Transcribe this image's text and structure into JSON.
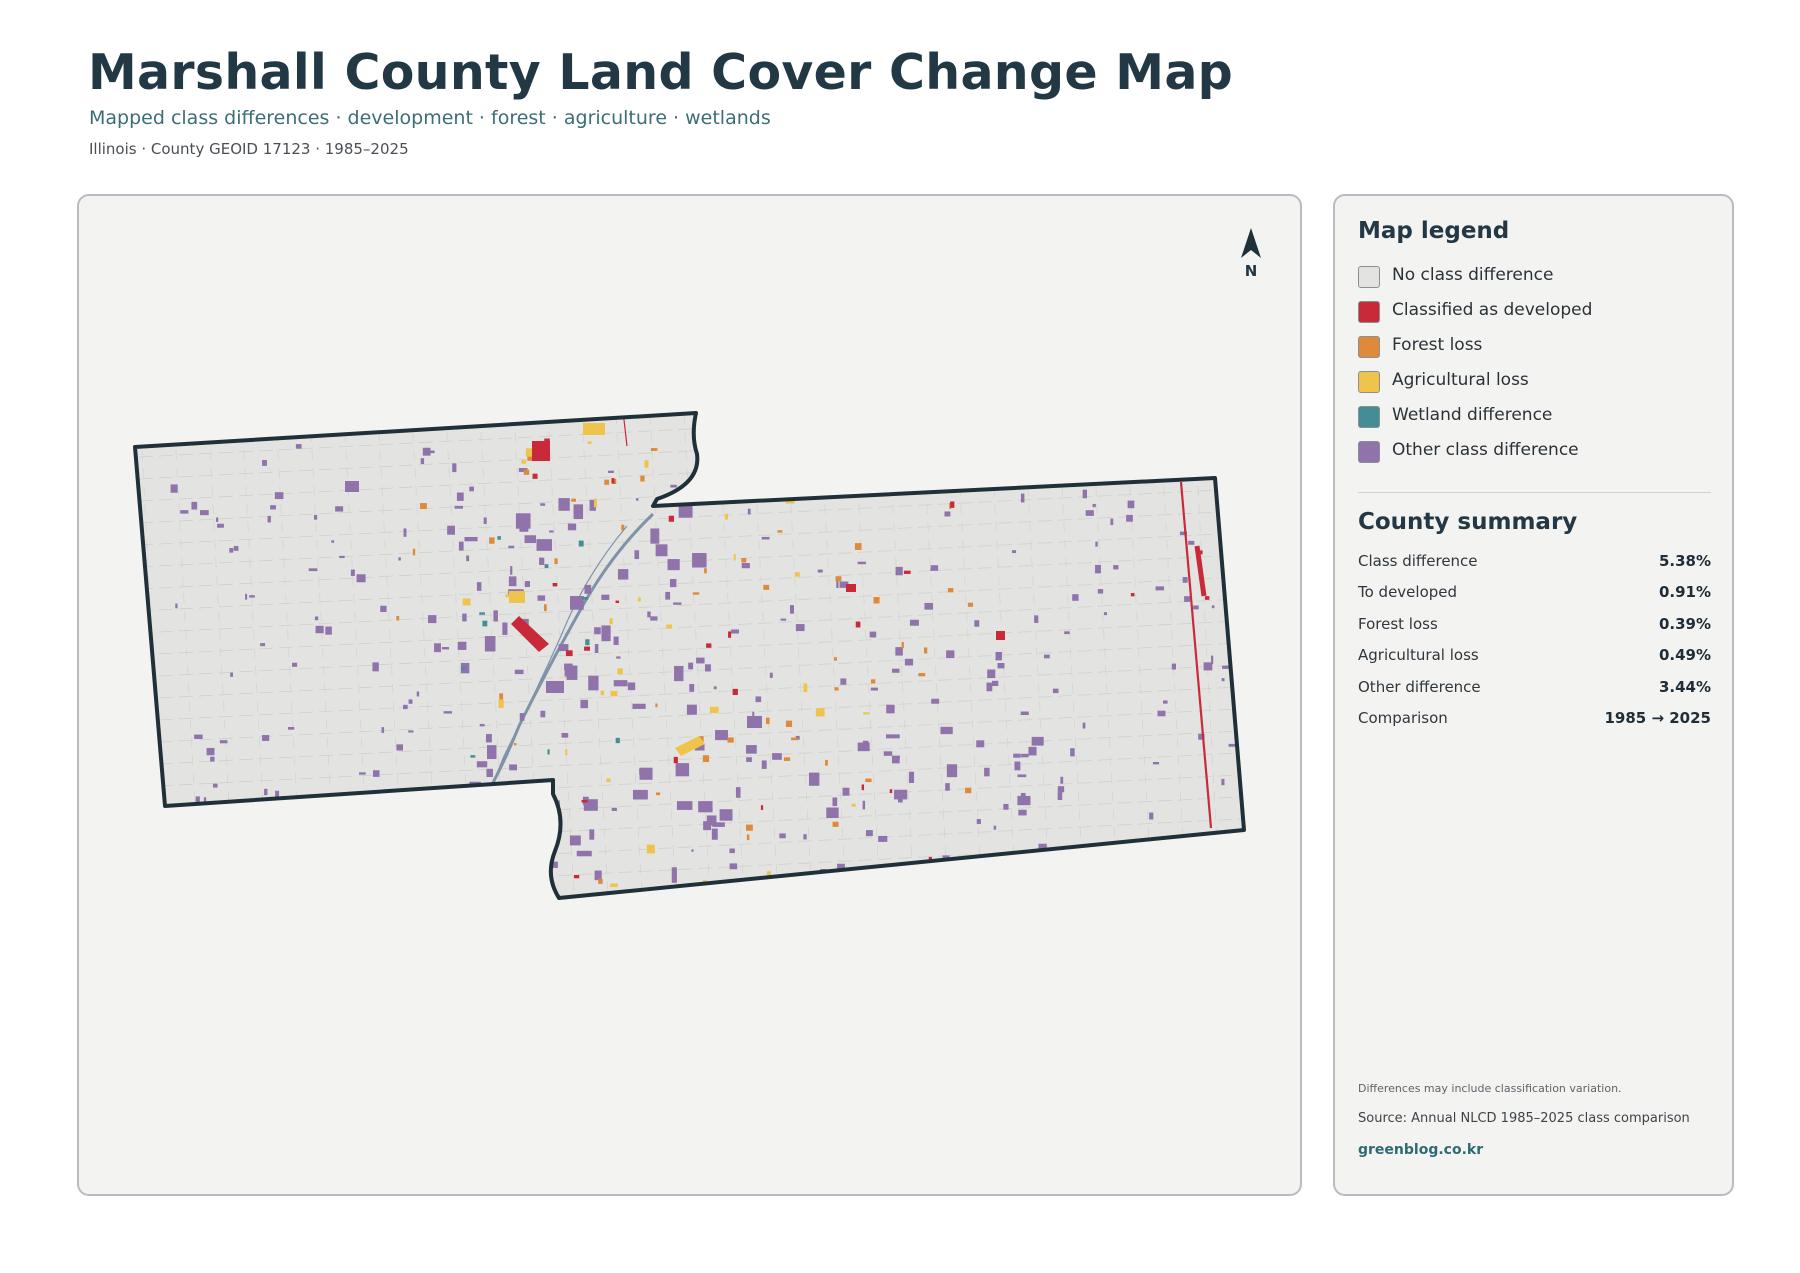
{
  "header": {
    "title": "Marshall County Land Cover Change Map",
    "subtitle": "Mapped class differences · development · forest · agriculture · wetlands",
    "meta": "Illinois · County GEOID 17123 · 1985–2025"
  },
  "map": {
    "north_label": "N",
    "colors": {
      "no_difference": "#e3e4e1",
      "developed": "#c82a3a",
      "forest_loss": "#df8a3b",
      "agricultural_loss": "#efc44d",
      "wetland": "#458d96",
      "other": "#8f73aa",
      "outline": "#203038",
      "river": "#7f93a8"
    }
  },
  "legend": {
    "heading": "Map legend",
    "items": [
      {
        "label": "No class difference",
        "color": "#e3e4e1"
      },
      {
        "label": "Classified as developed",
        "color": "#c82a3a"
      },
      {
        "label": "Forest loss",
        "color": "#df8a3b"
      },
      {
        "label": "Agricultural loss",
        "color": "#efc44d"
      },
      {
        "label": "Wetland difference",
        "color": "#458d96"
      },
      {
        "label": "Other class difference",
        "color": "#8f73aa"
      }
    ]
  },
  "summary": {
    "heading": "County summary",
    "rows": [
      {
        "label": "Class difference",
        "value": "5.38%"
      },
      {
        "label": "To developed",
        "value": "0.91%"
      },
      {
        "label": "Forest loss",
        "value": "0.39%"
      },
      {
        "label": "Agricultural loss",
        "value": "0.49%"
      },
      {
        "label": "Other difference",
        "value": "3.44%"
      },
      {
        "label": "Comparison",
        "value": "1985 → 2025"
      }
    ]
  },
  "footer": {
    "note": "Differences may include classification variation.",
    "source": "Source: Annual NLCD 1985–2025 class comparison",
    "site": "greenblog.co.kr"
  }
}
